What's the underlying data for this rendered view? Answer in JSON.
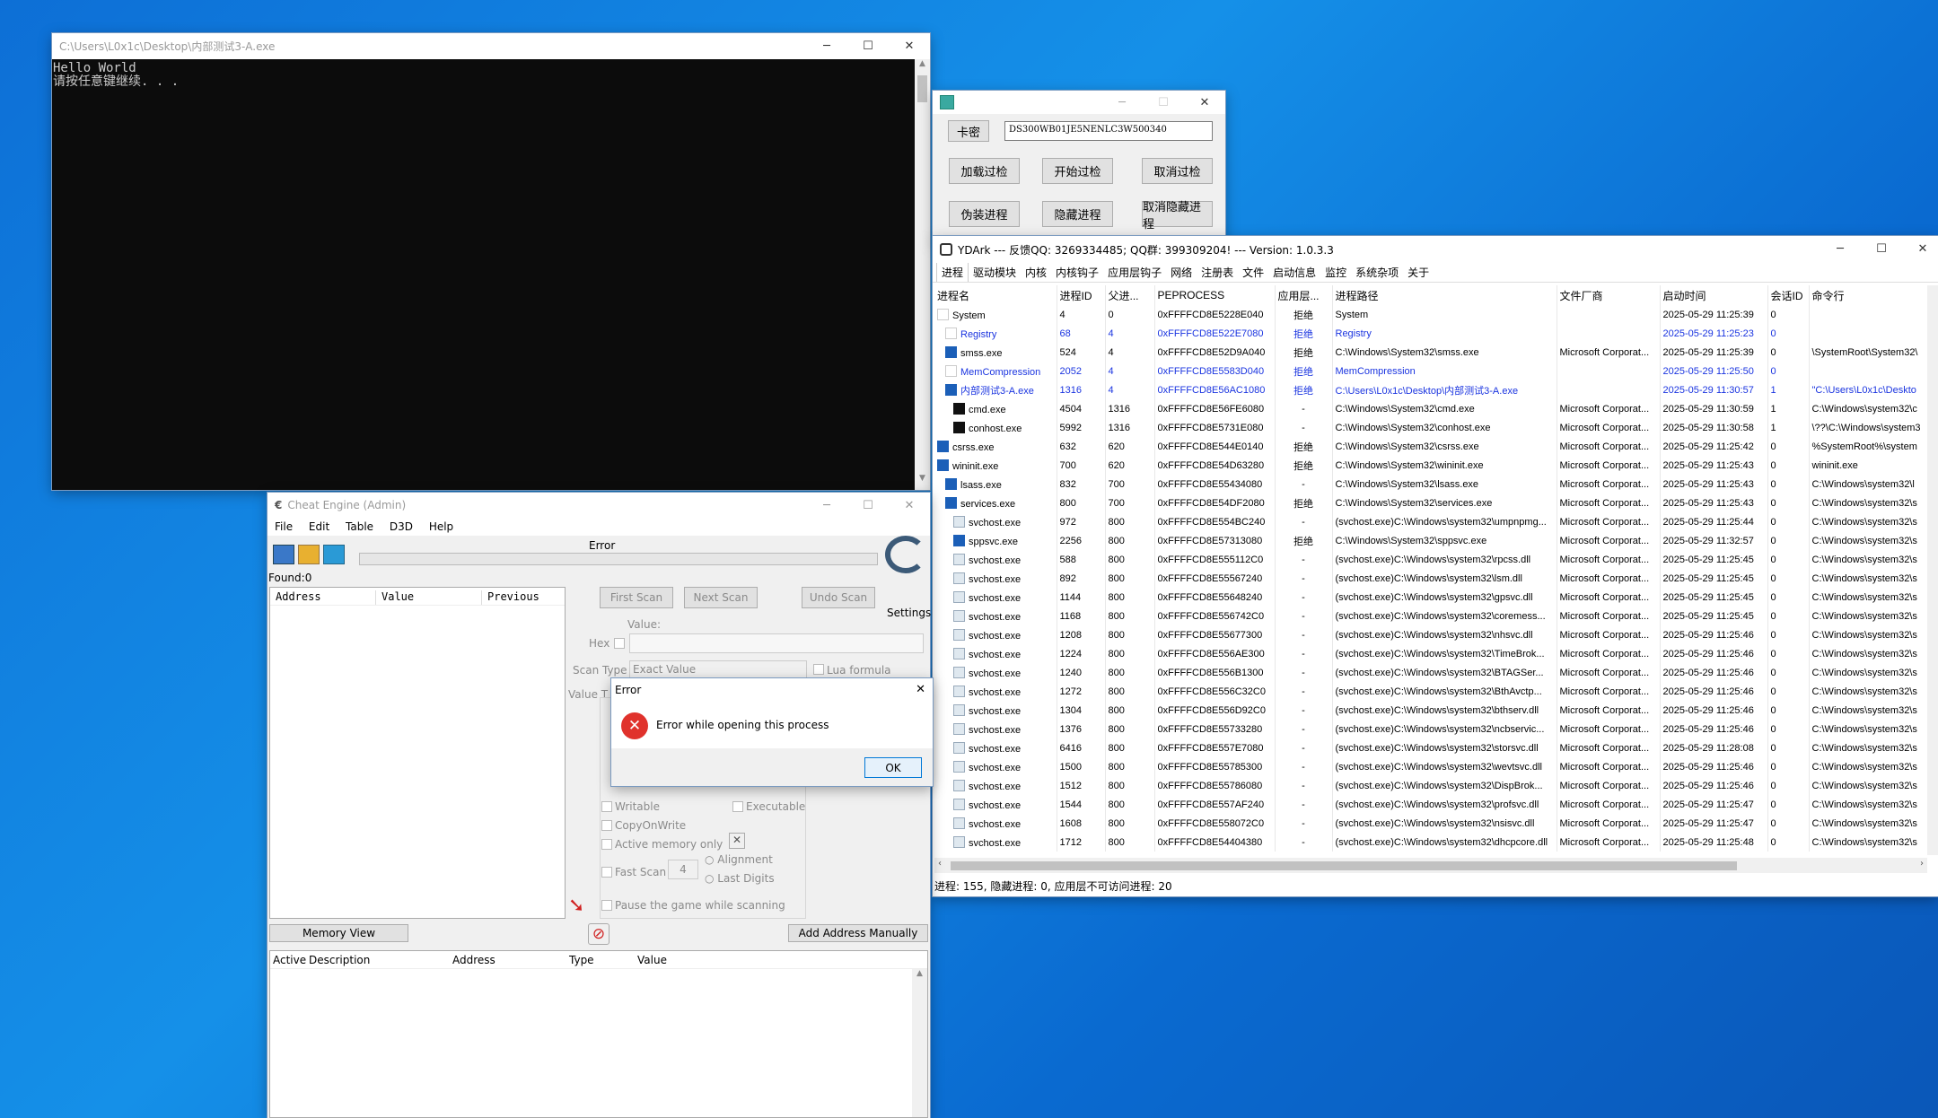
{
  "console": {
    "title": "C:\\Users\\L0x1c\\Desktop\\内部测试3-A.exe",
    "lines": [
      "Hello World",
      "请按任意键继续. . ."
    ]
  },
  "loader": {
    "key_label": "卡密",
    "key_value": "DS300WB01JE5NENLC3W500340",
    "buttons": [
      "加载过检",
      "开始过检",
      "取消过检",
      "伪装进程",
      "隐藏进程",
      "取消隐藏进程"
    ]
  },
  "ce": {
    "title": "Cheat Engine (Admin)",
    "menu": [
      "File",
      "Edit",
      "Table",
      "D3D",
      "Help"
    ],
    "status": "Error",
    "found": "Found:0",
    "list_cols": [
      "Address",
      "Value",
      "Previous"
    ],
    "first_scan": "First Scan",
    "next_scan": "Next Scan",
    "undo_scan": "Undo Scan",
    "settings": "Settings",
    "value_label": "Value:",
    "hex": "Hex",
    "scan_type_label": "Scan Type",
    "scan_type_value": "Exact Value",
    "lua": "Lua formula",
    "value_type_label": "Value T",
    "writable": "Writable",
    "executable": "Executable",
    "copyonwrite": "CopyOnWrite",
    "active_mem": "Active memory only",
    "fast_scan": "Fast Scan",
    "fast_val": "4",
    "alignment": "Alignment",
    "last_digits": "Last Digits",
    "pause": "Pause the game while scanning",
    "memory_view": "Memory View",
    "add_manual": "Add Address Manually",
    "table_cols": [
      "Active",
      "Description",
      "Address",
      "Type",
      "Value"
    ]
  },
  "error_dialog": {
    "title": "Error",
    "message": "Error while opening this process",
    "ok": "OK"
  },
  "yd": {
    "title": "YDArk --- 反馈QQ: 3269334485; QQ群: 399309204! --- Version: 1.0.3.3",
    "tabs": [
      "进程",
      "驱动模块",
      "内核",
      "内核钩子",
      "应用层钩子",
      "网络",
      "注册表",
      "文件",
      "启动信息",
      "监控",
      "系统杂项",
      "关于"
    ],
    "cols": [
      "进程名",
      "进程ID",
      "父进...",
      "PEPROCESS",
      "应用层...",
      "进程路径",
      "文件厂商",
      "启动时间",
      "会话ID",
      "命令行"
    ],
    "rows": [
      {
        "icon": "blank",
        "indent": 0,
        "blue": false,
        "c": [
          "System",
          "4",
          "0",
          "0xFFFFCD8E5228E040",
          "拒绝",
          "System",
          "",
          "2025-05-29 11:25:39",
          "0",
          ""
        ]
      },
      {
        "icon": "blank",
        "indent": 1,
        "blue": true,
        "c": [
          "Registry",
          "68",
          "4",
          "0xFFFFCD8E522E7080",
          "拒绝",
          "Registry",
          "",
          "2025-05-29 11:25:23",
          "0",
          ""
        ]
      },
      {
        "icon": "sys",
        "indent": 1,
        "blue": false,
        "c": [
          "smss.exe",
          "524",
          "4",
          "0xFFFFCD8E52D9A040",
          "拒绝",
          "C:\\Windows\\System32\\smss.exe",
          "Microsoft Corporat...",
          "2025-05-29 11:25:39",
          "0",
          "\\SystemRoot\\System32\\"
        ]
      },
      {
        "icon": "blank",
        "indent": 1,
        "blue": true,
        "c": [
          "MemCompression",
          "2052",
          "4",
          "0xFFFFCD8E5583D040",
          "拒绝",
          "MemCompression",
          "",
          "2025-05-29 11:25:50",
          "0",
          ""
        ]
      },
      {
        "icon": "sys",
        "indent": 1,
        "blue": true,
        "c": [
          "内部测试3-A.exe",
          "1316",
          "4",
          "0xFFFFCD8E56AC1080",
          "拒绝",
          "C:\\Users\\L0x1c\\Desktop\\内部测试3-A.exe",
          "",
          "2025-05-29 11:30:57",
          "1",
          "\"C:\\Users\\L0x1c\\Deskto"
        ]
      },
      {
        "icon": "cmd",
        "indent": 2,
        "blue": false,
        "c": [
          "cmd.exe",
          "4504",
          "1316",
          "0xFFFFCD8E56FE6080",
          "-",
          "C:\\Windows\\System32\\cmd.exe",
          "Microsoft Corporat...",
          "2025-05-29 11:30:59",
          "1",
          "C:\\Windows\\system32\\c"
        ]
      },
      {
        "icon": "cmd",
        "indent": 2,
        "blue": false,
        "c": [
          "conhost.exe",
          "5992",
          "1316",
          "0xFFFFCD8E5731E080",
          "-",
          "C:\\Windows\\System32\\conhost.exe",
          "Microsoft Corporat...",
          "2025-05-29 11:30:58",
          "1",
          "\\??\\C:\\Windows\\system3"
        ]
      },
      {
        "icon": "sys",
        "indent": 0,
        "blue": false,
        "c": [
          "csrss.exe",
          "632",
          "620",
          "0xFFFFCD8E544E0140",
          "拒绝",
          "C:\\Windows\\System32\\csrss.exe",
          "Microsoft Corporat...",
          "2025-05-29 11:25:42",
          "0",
          "%SystemRoot%\\system"
        ]
      },
      {
        "icon": "sys",
        "indent": 0,
        "blue": false,
        "c": [
          "wininit.exe",
          "700",
          "620",
          "0xFFFFCD8E54D63280",
          "拒绝",
          "C:\\Windows\\System32\\wininit.exe",
          "Microsoft Corporat...",
          "2025-05-29 11:25:43",
          "0",
          "wininit.exe"
        ]
      },
      {
        "icon": "sys",
        "indent": 1,
        "blue": false,
        "c": [
          "lsass.exe",
          "832",
          "700",
          "0xFFFFCD8E55434080",
          "-",
          "C:\\Windows\\System32\\lsass.exe",
          "Microsoft Corporat...",
          "2025-05-29 11:25:43",
          "0",
          "C:\\Windows\\system32\\l"
        ]
      },
      {
        "icon": "sys",
        "indent": 1,
        "blue": false,
        "c": [
          "services.exe",
          "800",
          "700",
          "0xFFFFCD8E54DF2080",
          "拒绝",
          "C:\\Windows\\System32\\services.exe",
          "Microsoft Corporat...",
          "2025-05-29 11:25:43",
          "0",
          "C:\\Windows\\system32\\s"
        ]
      },
      {
        "icon": "svc",
        "indent": 2,
        "blue": false,
        "c": [
          "svchost.exe",
          "972",
          "800",
          "0xFFFFCD8E554BC240",
          "-",
          "(svchost.exe)C:\\Windows\\system32\\umpnpmg...",
          "Microsoft Corporat...",
          "2025-05-29 11:25:44",
          "0",
          "C:\\Windows\\system32\\s"
        ]
      },
      {
        "icon": "sys",
        "indent": 2,
        "blue": false,
        "c": [
          "sppsvc.exe",
          "2256",
          "800",
          "0xFFFFCD8E57313080",
          "拒绝",
          "C:\\Windows\\System32\\sppsvc.exe",
          "Microsoft Corporat...",
          "2025-05-29 11:32:57",
          "0",
          "C:\\Windows\\system32\\s"
        ]
      },
      {
        "icon": "svc",
        "indent": 2,
        "blue": false,
        "c": [
          "svchost.exe",
          "588",
          "800",
          "0xFFFFCD8E555112C0",
          "-",
          "(svchost.exe)C:\\Windows\\system32\\rpcss.dll",
          "Microsoft Corporat...",
          "2025-05-29 11:25:45",
          "0",
          "C:\\Windows\\system32\\s"
        ]
      },
      {
        "icon": "svc",
        "indent": 2,
        "blue": false,
        "c": [
          "svchost.exe",
          "892",
          "800",
          "0xFFFFCD8E55567240",
          "-",
          "(svchost.exe)C:\\Windows\\system32\\lsm.dll",
          "Microsoft Corporat...",
          "2025-05-29 11:25:45",
          "0",
          "C:\\Windows\\system32\\s"
        ]
      },
      {
        "icon": "svc",
        "indent": 2,
        "blue": false,
        "c": [
          "svchost.exe",
          "1144",
          "800",
          "0xFFFFCD8E55648240",
          "-",
          "(svchost.exe)C:\\Windows\\system32\\gpsvc.dll",
          "Microsoft Corporat...",
          "2025-05-29 11:25:45",
          "0",
          "C:\\Windows\\system32\\s"
        ]
      },
      {
        "icon": "svc",
        "indent": 2,
        "blue": false,
        "c": [
          "svchost.exe",
          "1168",
          "800",
          "0xFFFFCD8E556742C0",
          "-",
          "(svchost.exe)C:\\Windows\\system32\\coremess...",
          "Microsoft Corporat...",
          "2025-05-29 11:25:45",
          "0",
          "C:\\Windows\\system32\\s"
        ]
      },
      {
        "icon": "svc",
        "indent": 2,
        "blue": false,
        "c": [
          "svchost.exe",
          "1208",
          "800",
          "0xFFFFCD8E55677300",
          "-",
          "(svchost.exe)C:\\Windows\\system32\\nhsvc.dll",
          "Microsoft Corporat...",
          "2025-05-29 11:25:46",
          "0",
          "C:\\Windows\\system32\\s"
        ]
      },
      {
        "icon": "svc",
        "indent": 2,
        "blue": false,
        "c": [
          "svchost.exe",
          "1224",
          "800",
          "0xFFFFCD8E556AE300",
          "-",
          "(svchost.exe)C:\\Windows\\system32\\TimeBrok...",
          "Microsoft Corporat...",
          "2025-05-29 11:25:46",
          "0",
          "C:\\Windows\\system32\\s"
        ]
      },
      {
        "icon": "svc",
        "indent": 2,
        "blue": false,
        "c": [
          "svchost.exe",
          "1240",
          "800",
          "0xFFFFCD8E556B1300",
          "-",
          "(svchost.exe)C:\\Windows\\system32\\BTAGSer...",
          "Microsoft Corporat...",
          "2025-05-29 11:25:46",
          "0",
          "C:\\Windows\\system32\\s"
        ]
      },
      {
        "icon": "svc",
        "indent": 2,
        "blue": false,
        "c": [
          "svchost.exe",
          "1272",
          "800",
          "0xFFFFCD8E556C32C0",
          "-",
          "(svchost.exe)C:\\Windows\\system32\\BthAvctp...",
          "Microsoft Corporat...",
          "2025-05-29 11:25:46",
          "0",
          "C:\\Windows\\system32\\s"
        ]
      },
      {
        "icon": "svc",
        "indent": 2,
        "blue": false,
        "c": [
          "svchost.exe",
          "1304",
          "800",
          "0xFFFFCD8E556D92C0",
          "-",
          "(svchost.exe)C:\\Windows\\system32\\bthserv.dll",
          "Microsoft Corporat...",
          "2025-05-29 11:25:46",
          "0",
          "C:\\Windows\\system32\\s"
        ]
      },
      {
        "icon": "svc",
        "indent": 2,
        "blue": false,
        "c": [
          "svchost.exe",
          "1376",
          "800",
          "0xFFFFCD8E55733280",
          "-",
          "(svchost.exe)C:\\Windows\\system32\\ncbservic...",
          "Microsoft Corporat...",
          "2025-05-29 11:25:46",
          "0",
          "C:\\Windows\\system32\\s"
        ]
      },
      {
        "icon": "svc",
        "indent": 2,
        "blue": false,
        "c": [
          "svchost.exe",
          "6416",
          "800",
          "0xFFFFCD8E557E7080",
          "-",
          "(svchost.exe)C:\\Windows\\system32\\storsvc.dll",
          "Microsoft Corporat...",
          "2025-05-29 11:28:08",
          "0",
          "C:\\Windows\\system32\\s"
        ]
      },
      {
        "icon": "svc",
        "indent": 2,
        "blue": false,
        "c": [
          "svchost.exe",
          "1500",
          "800",
          "0xFFFFCD8E55785300",
          "-",
          "(svchost.exe)C:\\Windows\\system32\\wevtsvc.dll",
          "Microsoft Corporat...",
          "2025-05-29 11:25:46",
          "0",
          "C:\\Windows\\system32\\s"
        ]
      },
      {
        "icon": "svc",
        "indent": 2,
        "blue": false,
        "c": [
          "svchost.exe",
          "1512",
          "800",
          "0xFFFFCD8E55786080",
          "-",
          "(svchost.exe)C:\\Windows\\system32\\DispBrok...",
          "Microsoft Corporat...",
          "2025-05-29 11:25:46",
          "0",
          "C:\\Windows\\system32\\s"
        ]
      },
      {
        "icon": "svc",
        "indent": 2,
        "blue": false,
        "c": [
          "svchost.exe",
          "1544",
          "800",
          "0xFFFFCD8E557AF240",
          "-",
          "(svchost.exe)C:\\Windows\\system32\\profsvc.dll",
          "Microsoft Corporat...",
          "2025-05-29 11:25:47",
          "0",
          "C:\\Windows\\system32\\s"
        ]
      },
      {
        "icon": "svc",
        "indent": 2,
        "blue": false,
        "c": [
          "svchost.exe",
          "1608",
          "800",
          "0xFFFFCD8E558072C0",
          "-",
          "(svchost.exe)C:\\Windows\\system32\\nsisvc.dll",
          "Microsoft Corporat...",
          "2025-05-29 11:25:47",
          "0",
          "C:\\Windows\\system32\\s"
        ]
      },
      {
        "icon": "svc",
        "indent": 2,
        "blue": false,
        "c": [
          "svchost.exe",
          "1712",
          "800",
          "0xFFFFCD8E54404380",
          "-",
          "(svchost.exe)C:\\Windows\\system32\\dhcpcore.dll",
          "Microsoft Corporat...",
          "2025-05-29 11:25:48",
          "0",
          "C:\\Windows\\system32\\s"
        ]
      }
    ],
    "status": "进程:  155, 隐藏进程:  0, 应用层不可访问进程:  20"
  }
}
